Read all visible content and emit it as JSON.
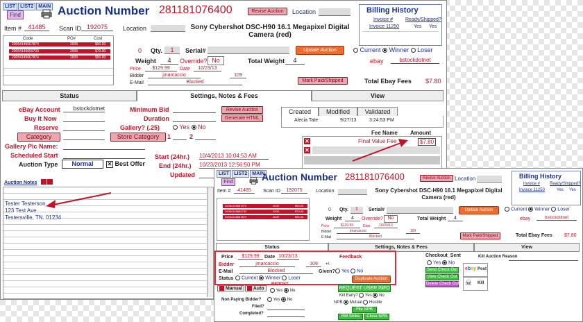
{
  "nav_tabs": [
    "LIST",
    "LIST2",
    "MAIN"
  ],
  "find_label": "Find",
  "title": "Auction Number",
  "auction_number": "281181076400",
  "revise_auction": "Revise Auction",
  "location_label": "Location",
  "item_label": "Item #",
  "item_value": "41485",
  "scan_label": "Scan ID",
  "scan_value": "192075",
  "product_title": "Sony Cybershot DSC-H90 16.1 Megapixel Digital Camera (red)",
  "codes_headers": [
    "Code",
    "PO#",
    "Cost"
  ],
  "codes_rows": [
    {
      "code": "20054145667874",
      "po": "2005",
      "cost": "$50.00"
    },
    {
      "code": "20054145659733",
      "po": "2005",
      "cost": "$70.00"
    },
    {
      "code": "20054145667874",
      "po": "2005",
      "cost": "$50.00"
    }
  ],
  "qty_zero": "0",
  "qty_label": "Qty.",
  "qty_value": "1",
  "serial_label": "Serial#",
  "update_auction": "Update Auction",
  "status_options": [
    "Current",
    "Winner",
    "Loser"
  ],
  "weight_label": "Weight",
  "weight_value": "4",
  "override_label": "Override?",
  "override_value": "No",
  "total_weight_label": "Total Weight",
  "total_weight_value": "4",
  "ebay_label": "ebay",
  "ebay_account": "bstockdotnet",
  "price_label": "Price",
  "price_value": "$129.99",
  "date_label": "Date",
  "date_value": "10/23/13",
  "bidder_label": "Bidder",
  "bidder_value": "jmarcaccio",
  "bidder_num": "109",
  "email_label": "E-Mail",
  "email_value": "Blocked",
  "mark_paid": "Mark Paid/Shipped",
  "total_fees_label": "Total Ebay Fees",
  "total_fees_value": "$7.80",
  "billing": {
    "title": "Billing History",
    "col_invoice": "Invoice #",
    "col_ready": "Ready/Shipped?",
    "invoice": "Invoice 11250",
    "yes1": "Yes",
    "yes2": "Yes"
  },
  "main_tabs": [
    "Status",
    "Settings, Notes & Fees",
    "View"
  ],
  "settings": {
    "ebay_account_label": "eBay Account",
    "ebay_account_value": "bstockdotnet",
    "buy_it_now": "Buy It Now",
    "reserve": "Reserve",
    "category": "Category",
    "pic_name": "Gallery Pic Name:",
    "scheduled": "Scheduled Start",
    "auction_type_label": "Auction Type",
    "auction_type_value": "Normal",
    "best_offer": "Best Offer",
    "min_bid": "Minimum Bid",
    "duration": "Duration",
    "gallery": "Gallery? (.25)",
    "gallery_yes": "Yes",
    "gallery_no": "No",
    "store_category": "Store Category",
    "store_1": "1",
    "store_2": "2",
    "start_label": "Start (24hr.)",
    "start_value": "10/4/2013 10:04:53 AM",
    "end_label": "End (24hr.)",
    "end_value": "10/23/2013 12:56:50 PM",
    "updated_label": "Updated",
    "revise_auction": "Revise Auction",
    "generate_html": "Generate HTML"
  },
  "cmv_tabs": [
    "Created",
    "Modified",
    "Validated"
  ],
  "cmv_row": {
    "name": "Alecia Tate",
    "date": "9/27/13",
    "time": "3:24:53 PM"
  },
  "fee_headers": [
    "Fee Name",
    "Amount"
  ],
  "fee_row": {
    "name": "Final Value Fee",
    "amount": "$7.80"
  },
  "auction_notes_label": "Auction Notes",
  "notes_lines": [
    "Tester Testerson",
    "123 Test Ave.",
    "Testersville, TN. 01234"
  ],
  "status_panel": {
    "feedback": "Feedback",
    "given": "Given?",
    "yes": "Yes",
    "no": "No",
    "status_label": "Status",
    "duplicate": "Duplicate Auction",
    "plus": "+/-"
  },
  "checkout": {
    "label": "Checkout_Sent",
    "yes": "Yes",
    "no": "No",
    "send": "Send Check Out",
    "view": "View Check Out",
    "delete": "Delete Check Out"
  },
  "kill_label": "Kill Auction Reason",
  "post_label": "Post",
  "kill_btn": "Kill",
  "bottom": {
    "manual": "Manual",
    "auto": "Auto",
    "repost": "REPOST",
    "repost_yes": "Yes",
    "repost_no": "No",
    "non_paying": "Non Paying Bidder?",
    "filed": "Filed?",
    "completed": "Completed?",
    "request_user_info": "REQUEST USER INFO",
    "kill_early": "Kill Early?",
    "npb": "NPB",
    "mutual": "Mutual",
    "hostile": "Hostile",
    "file_npb": "File NPB",
    "rm_strike": "RM Strike",
    "close_npb": "Close NPB"
  },
  "colors": {
    "accent_red": "#c0142a",
    "navy": "#1a2f8a",
    "highlight": "#e12a3a",
    "orange": "#ee6d2e",
    "green": "#3ec143"
  },
  "icons": [
    "printer-icon",
    "checkbox-icon",
    "close-icon",
    "skull-icon",
    "ebay-logo-icon"
  ]
}
